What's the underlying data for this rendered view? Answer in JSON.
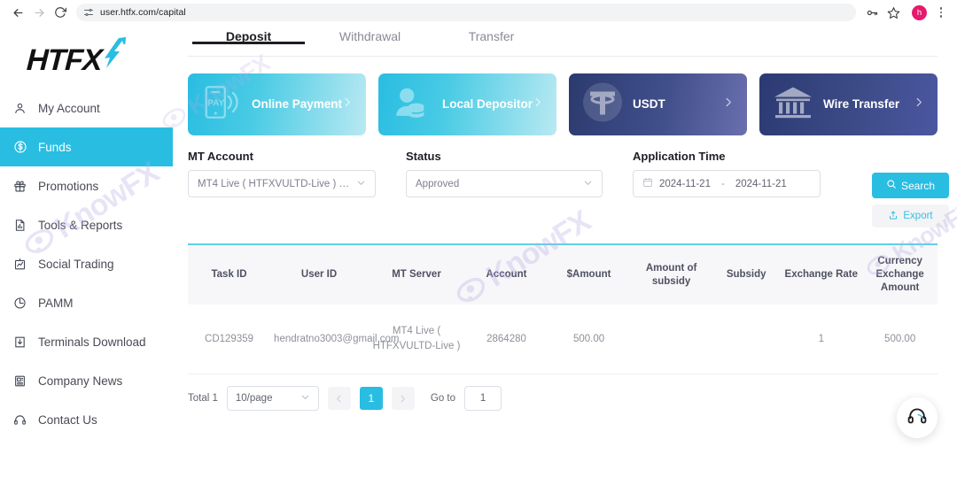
{
  "browser": {
    "back_icon": "back-arrow-icon",
    "forward_icon": "forward-arrow-icon",
    "reload_icon": "reload-icon",
    "site_settings_icon": "site-settings-icon",
    "url": "user.htfx.com/capital",
    "password_icon": "password-key-icon",
    "bookmark_icon": "star-icon",
    "avatar_letter": "h",
    "menu_icon": "three-dot-menu-icon"
  },
  "sidebar": {
    "logo_text": "HTFX",
    "items": [
      {
        "label": "My Account",
        "icon": "user-icon",
        "active": false
      },
      {
        "label": "Funds",
        "icon": "dollar-circle-icon",
        "active": true
      },
      {
        "label": "Promotions",
        "icon": "gift-icon",
        "active": false
      },
      {
        "label": "Tools & Reports",
        "icon": "report-icon",
        "active": false
      },
      {
        "label": "Social Trading",
        "icon": "chart-board-icon",
        "active": false
      },
      {
        "label": "PAMM",
        "icon": "pie-chart-icon",
        "active": false
      },
      {
        "label": "Terminals Download",
        "icon": "download-icon",
        "active": false
      },
      {
        "label": "Company News",
        "icon": "news-icon",
        "active": false
      },
      {
        "label": "Contact Us",
        "icon": "headset-icon",
        "active": false
      }
    ]
  },
  "tabs": [
    {
      "label": "Deposit",
      "active": true
    },
    {
      "label": "Withdrawal",
      "active": false
    },
    {
      "label": "Transfer",
      "active": false
    }
  ],
  "cards": [
    {
      "title": "Online Payment",
      "icon": "mobile-pay-icon",
      "style": "cyan",
      "chevron": "chevron-right-icon"
    },
    {
      "title": "Local Depositor",
      "icon": "person-coins-icon",
      "style": "cyan",
      "chevron": "chevron-right-icon"
    },
    {
      "title": "USDT",
      "icon": "tether-icon",
      "style": "navy",
      "chevron": "chevron-right-icon"
    },
    {
      "title": "Wire Transfer",
      "icon": "bank-icon",
      "style": "navy2",
      "chevron": "chevron-right-icon"
    }
  ],
  "filters": {
    "mt_account": {
      "label": "MT Account",
      "value": "MT4 Live ( HTFXVULTD-Live ) 2...",
      "chevron": "chevron-down-icon"
    },
    "status": {
      "label": "Status",
      "value": "Approved",
      "chevron": "chevron-down-icon"
    },
    "application_time": {
      "label": "Application Time",
      "start": "2024-11-21",
      "separator": "-",
      "end": "2024-11-21",
      "calendar_icon": "calendar-icon"
    },
    "search_button": {
      "label": "Search",
      "icon": "search-icon"
    },
    "export_button": {
      "label": "Export",
      "icon": "upload-icon"
    }
  },
  "table": {
    "columns": [
      "Task ID",
      "User ID",
      "MT Server",
      "Account",
      "$Amount",
      "Amount of subsidy",
      "Subsidy",
      "Exchange Rate",
      "Currency Exchange Amount"
    ],
    "rows": [
      {
        "task_id": "CD129359",
        "user_id": "hendratno3003@gmail.com",
        "mt_server": "MT4 Live ( HTFXVULTD-Live )",
        "account": "2864280",
        "amount": "500.00",
        "amount_of_subsidy": "",
        "subsidy": "",
        "exchange_rate": "1",
        "currency_exchange_amount": "500.00"
      }
    ]
  },
  "pagination": {
    "total_label": "Total 1",
    "page_size": "10/page",
    "page_size_chevron": "chevron-down-icon",
    "prev_icon": "chevron-left-icon",
    "next_icon": "chevron-right-icon",
    "current_page": "1",
    "goto_label": "Go to",
    "goto_value": "1"
  },
  "support_fab": {
    "icon": "headset-icon"
  },
  "watermark": {
    "text": "KnowFX"
  },
  "colors": {
    "accent_cyan": "#29bde2",
    "navy": "#2b3a6e",
    "avatar_pink": "#e5196d",
    "watermark_purple": "#b9aee6",
    "tab_active": "#1d1d22"
  }
}
